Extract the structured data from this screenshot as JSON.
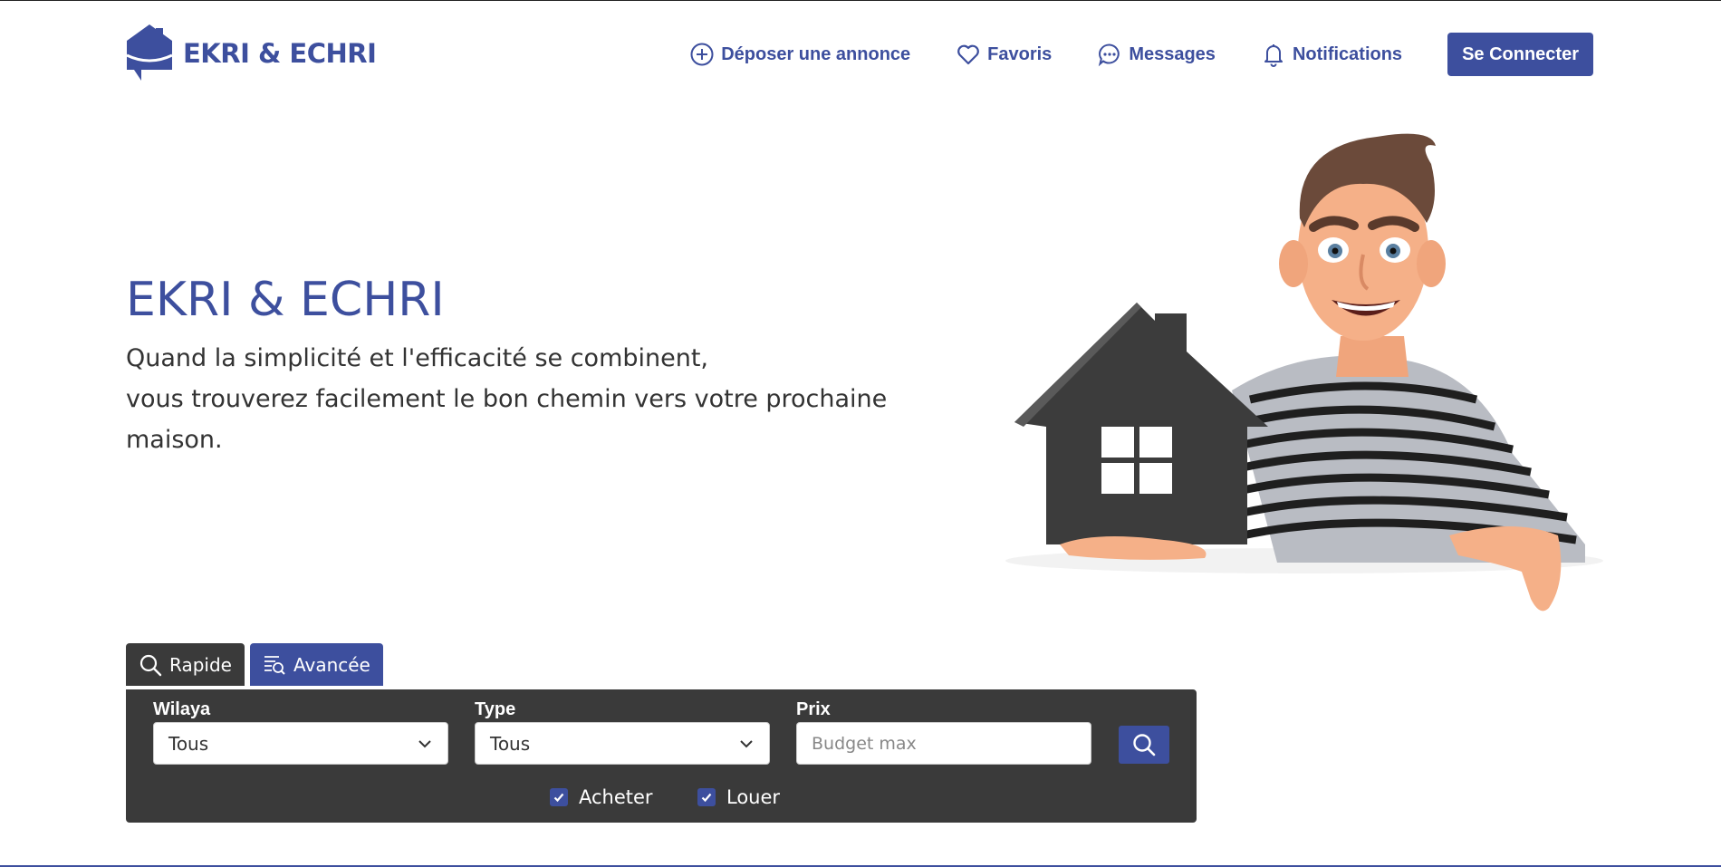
{
  "brand": {
    "name": "EKRI & ECHRI",
    "color": "#3d4f9e"
  },
  "nav": {
    "items": [
      {
        "label": "Déposer une annonce",
        "icon": "plus-circle-icon"
      },
      {
        "label": "Favoris",
        "icon": "heart-icon"
      },
      {
        "label": "Messages",
        "icon": "chat-bubble-icon"
      },
      {
        "label": "Notifications",
        "icon": "bell-icon"
      }
    ],
    "login_label": "Se Connecter"
  },
  "hero": {
    "title": "EKRI & ECHRI",
    "lines": [
      "Quand la simplicité et l'efficacité se combinent,",
      "vous trouverez facilement le bon chemin vers votre prochaine",
      "maison."
    ]
  },
  "search": {
    "tabs": [
      {
        "label": "Rapide",
        "icon": "search-icon",
        "color": "#3a3a3a"
      },
      {
        "label": "Avancée",
        "icon": "filter-search-icon",
        "color": "#3d4f9e"
      }
    ],
    "fields": {
      "wilaya": {
        "label": "Wilaya",
        "value": "Tous"
      },
      "type": {
        "label": "Type",
        "value": "Tous"
      },
      "prix": {
        "label": "Prix",
        "placeholder": "Budget max"
      }
    },
    "checkboxes": [
      {
        "label": "Acheter",
        "checked": true
      },
      {
        "label": "Louer",
        "checked": true
      }
    ]
  }
}
